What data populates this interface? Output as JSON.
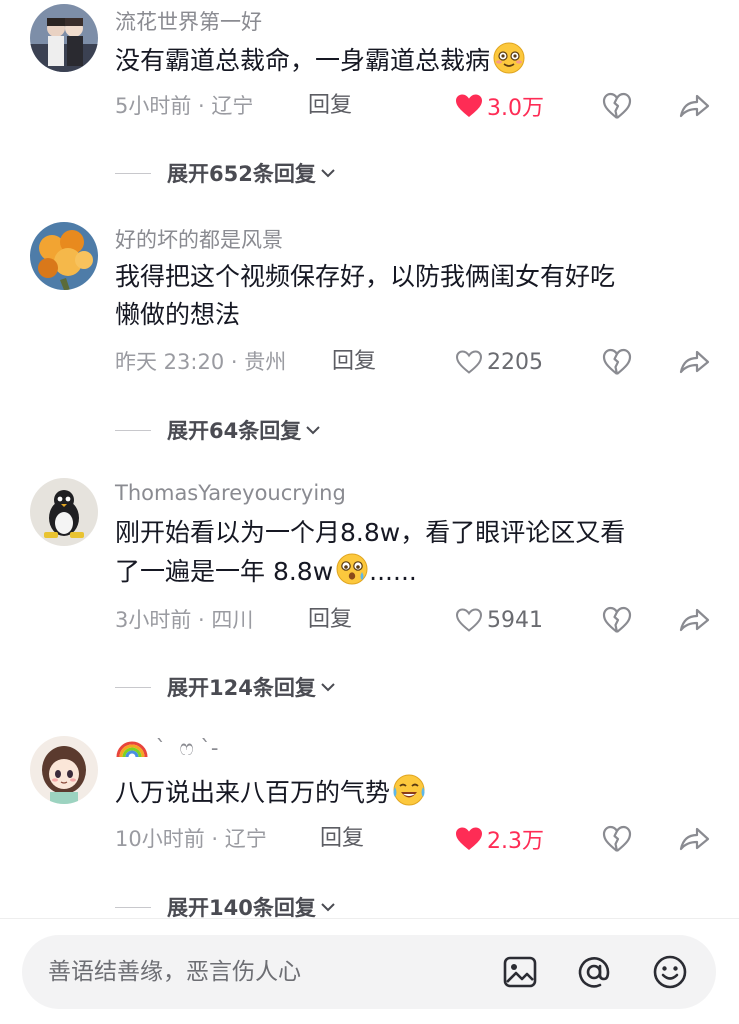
{
  "comments": [
    {
      "username": "流花世界第一好",
      "text_lines": [
        "没有霸道总裁命，一身霸道总裁病"
      ],
      "time_location": "5小时前 · 辽宁",
      "reply_label": "回复",
      "likes": "3.0万",
      "liked": true,
      "expand_label": "展开652条回复",
      "emoji": "smiling-face-emoji"
    },
    {
      "username": "好的坏的都是风景",
      "text_lines": [
        "我得把这个视频保存好，以防我俩闺女有好吃",
        "懒做的想法"
      ],
      "time_location": "昨天 23:20 · 贵州",
      "reply_label": "回复",
      "likes": "2205",
      "liked": false,
      "expand_label": "展开64条回复"
    },
    {
      "username": "ThomasYareyoucrying",
      "text_lines": [
        "刚开始看以为一个月8.8w，看了眼评论区又看",
        "了一遍是一年 8.8w"
      ],
      "text_suffix": "......",
      "time_location": "3小时前 · 四川",
      "reply_label": "回复",
      "likes": "5941",
      "liked": false,
      "expand_label": "展开124条回复",
      "emoji": "shocked-face-emoji"
    },
    {
      "username": " `  ෆ `-",
      "text_lines": [
        "八万说出来八百万的气势"
      ],
      "time_location": "10小时前 · 辽宁",
      "reply_label": "回复",
      "likes": "2.3万",
      "liked": true,
      "expand_label": "展开140条回复",
      "emoji": "laughing-crying-emoji",
      "name_icon": "rainbow-icon"
    }
  ],
  "input": {
    "placeholder": "善语结善缘，恶言伤人心"
  },
  "colors": {
    "like_red": "#fe2c55",
    "secondary_text": "#9a9ba1",
    "input_bg": "#f3f3f4"
  }
}
